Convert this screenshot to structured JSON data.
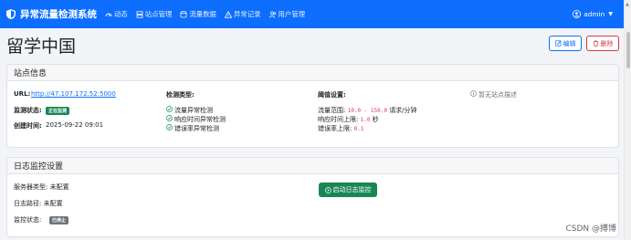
{
  "app": {
    "title": "异常流量检测系统"
  },
  "nav": {
    "items": [
      {
        "label": "动态"
      },
      {
        "label": "站点管理"
      },
      {
        "label": "流量数据"
      },
      {
        "label": "异常记录"
      },
      {
        "label": "用户管理"
      }
    ],
    "user": "admin"
  },
  "page": {
    "title": "留学中国",
    "edit_label": "编辑",
    "delete_label": "删除"
  },
  "site_info": {
    "header": "站点信息",
    "url_label": "URL:",
    "url_value": "http://47.107.172.52:5000",
    "status_label": "监测状态:",
    "status_badge": "正在监测",
    "created_label": "创建时间:",
    "created_value": "2025-09-22 09:01",
    "detection_label": "检测类型:",
    "detection_types": [
      "流量异常检测",
      "响应时间异常检测",
      "错误率异常检测"
    ],
    "threshold_label": "阈值设置:",
    "flow_label": "流量范围:",
    "flow_value": "10.0 - 150.0",
    "flow_unit": "请求/分钟",
    "resp_label": "响应时间上限:",
    "resp_value": "1.0",
    "resp_unit": "秒",
    "err_label": "错误率上限:",
    "err_value": "0.1",
    "desc": "暂无站点描述"
  },
  "log_monitor": {
    "header": "日志监控设置",
    "server_type": "服务器类型: 未配置",
    "log_path": "日志路径: 未配置",
    "status_label": "监控状态:",
    "status_badge": "已停止",
    "start_button": "启动日志监控"
  },
  "watermark": "CSDN @搏博",
  "colors": {
    "primary": "#0d6efd",
    "success": "#198754",
    "danger": "#dc3545",
    "secondary": "#6c757d"
  }
}
